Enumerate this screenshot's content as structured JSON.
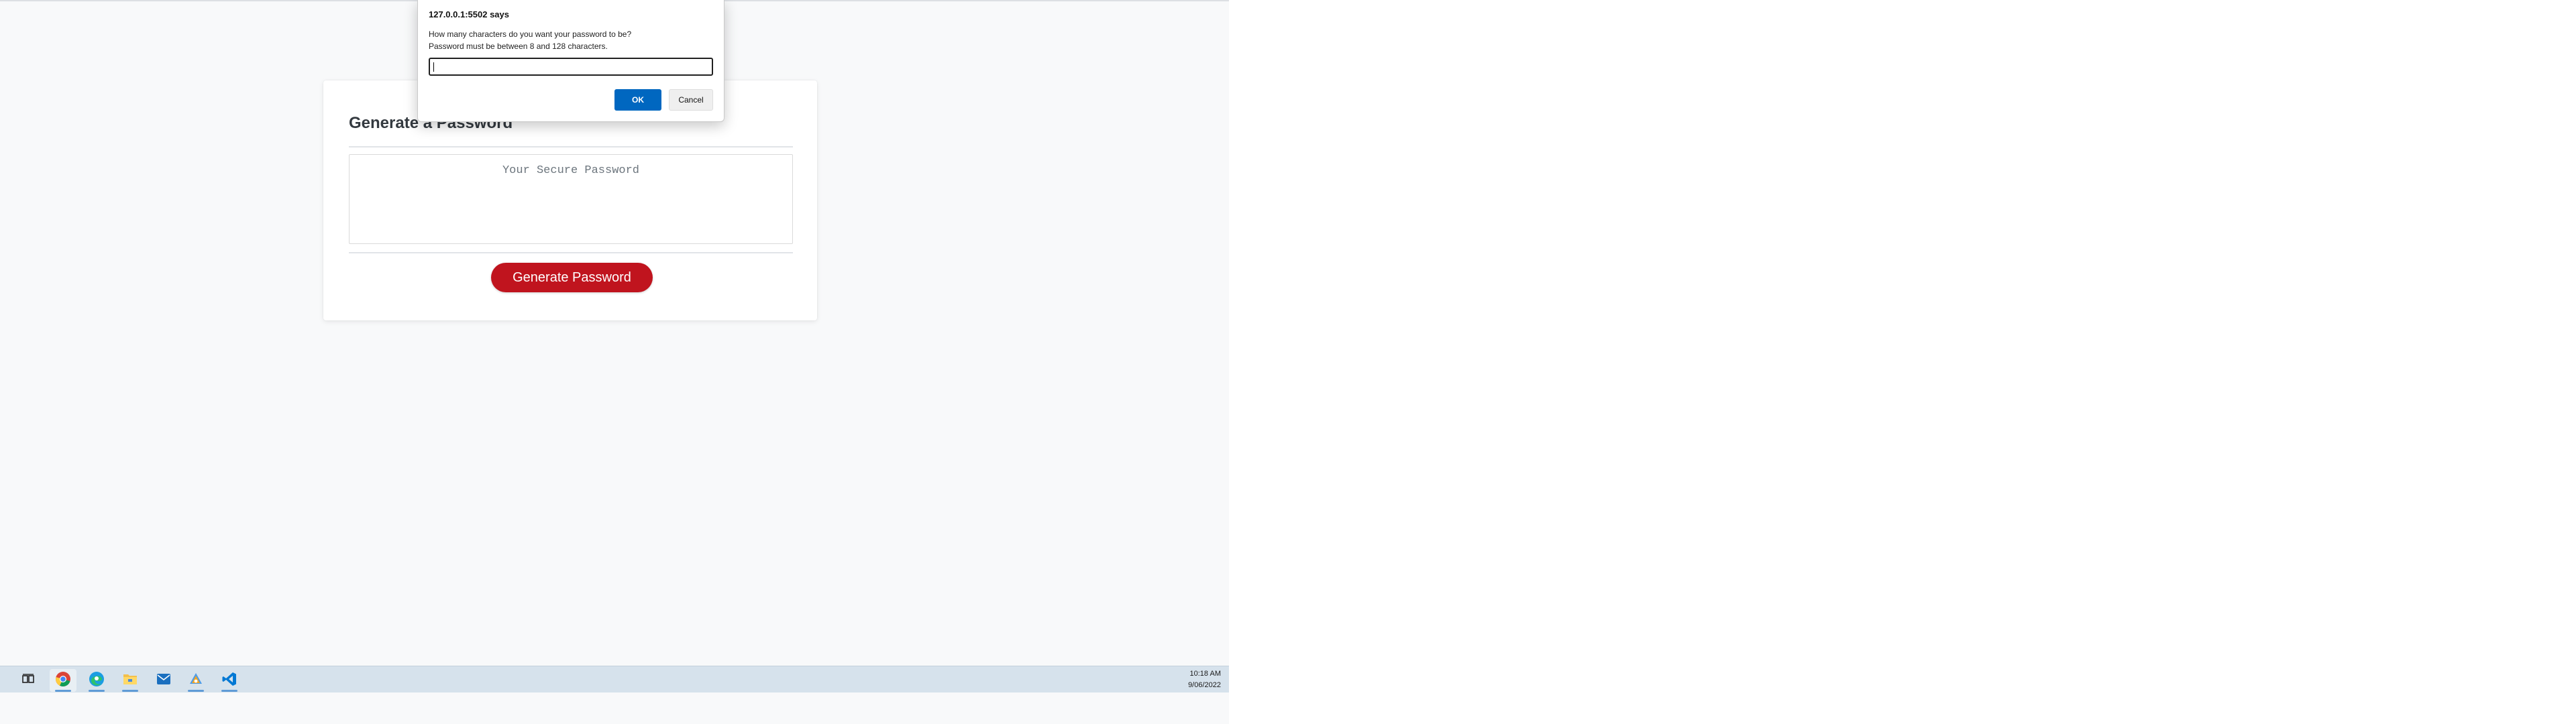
{
  "page": {
    "title": "Generate a Password",
    "password_placeholder": "Your Secure Password",
    "generate_button": "Generate Password"
  },
  "dialog": {
    "title": "127.0.0.1:5502 says",
    "message_line1": "How many characters do you want your password to be?",
    "message_line2": "Password must be between 8 and 128 characters.",
    "input_value": "",
    "ok_label": "OK",
    "cancel_label": "Cancel"
  },
  "taskbar": {
    "apps": [
      {
        "icon": "task-view-icon"
      },
      {
        "icon": "chrome-icon"
      },
      {
        "icon": "edge-icon"
      },
      {
        "icon": "file-explorer-icon"
      },
      {
        "icon": "mail-icon"
      },
      {
        "icon": "sourcetree-icon"
      },
      {
        "icon": "vscode-icon"
      }
    ],
    "time": "10:18 AM",
    "date": "9/06/2022"
  },
  "colors": {
    "generate_button": "#c0141e",
    "dialog_ok": "#0067c0",
    "taskbar": "#d6e2ec"
  }
}
